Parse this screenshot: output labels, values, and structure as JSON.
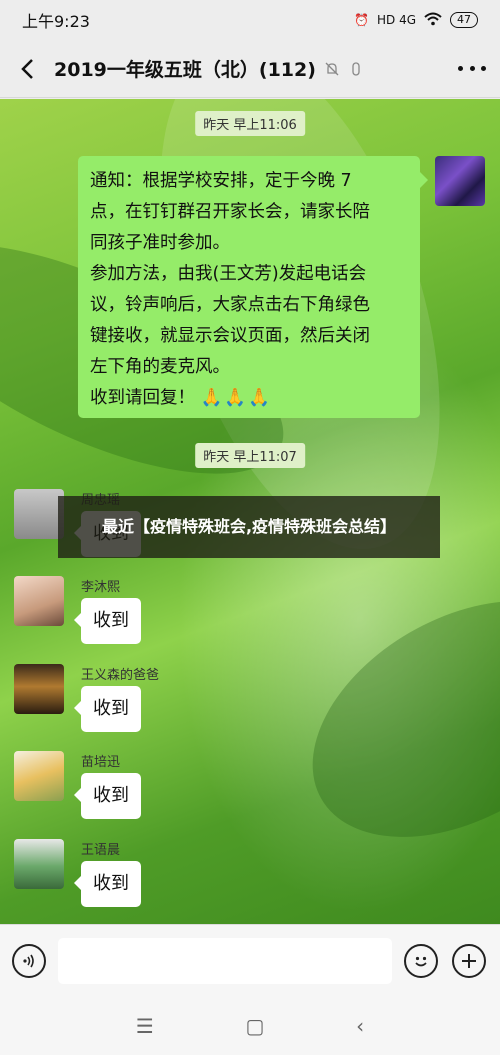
{
  "status_bar": {
    "time": "上午9:23",
    "network": "HD 4G",
    "battery": "47"
  },
  "header": {
    "title": "2019一年级五班（北）(112)",
    "back_icon": "chevron-left-icon",
    "mute_icon": "bell-off-icon",
    "link_icon": "link-icon",
    "more_icon": "more-dots-icon"
  },
  "messages": {
    "time1": "昨天 早上11:06",
    "notice_lines": [
      "通知：根据学校安排，定于今晚 7",
      "点，在钉钉群召开家长会，请家长陪",
      "同孩子准时参加。",
      "参加方法，由我(王文芳)发起电话会",
      "议，铃声响后，大家点击右下角绿色",
      "键接收，就显示会议页面，然后关闭",
      "左下角的麦克风。",
      "收到请回复！"
    ],
    "notice_emoji": "🙏🙏🙏",
    "time2": "昨天 早上11:07",
    "replies": [
      {
        "sender": "周忠瑶",
        "text": "收到"
      },
      {
        "sender": "李沐熙",
        "text": "收到"
      },
      {
        "sender": "王义森的爸爸",
        "text": "收到"
      },
      {
        "sender": "苗培迅",
        "text": "收到"
      },
      {
        "sender": "王语晨",
        "text": "收到"
      }
    ]
  },
  "banner": "最近【疫情特殊班会,疫情特殊班会总结】",
  "input_bar": {
    "voice_icon": "voice-icon",
    "emoji_icon": "emoji-icon",
    "plus_icon": "plus-icon",
    "text_value": ""
  },
  "system_nav": {
    "menu": "☰",
    "home": "▢",
    "back": "‹"
  }
}
